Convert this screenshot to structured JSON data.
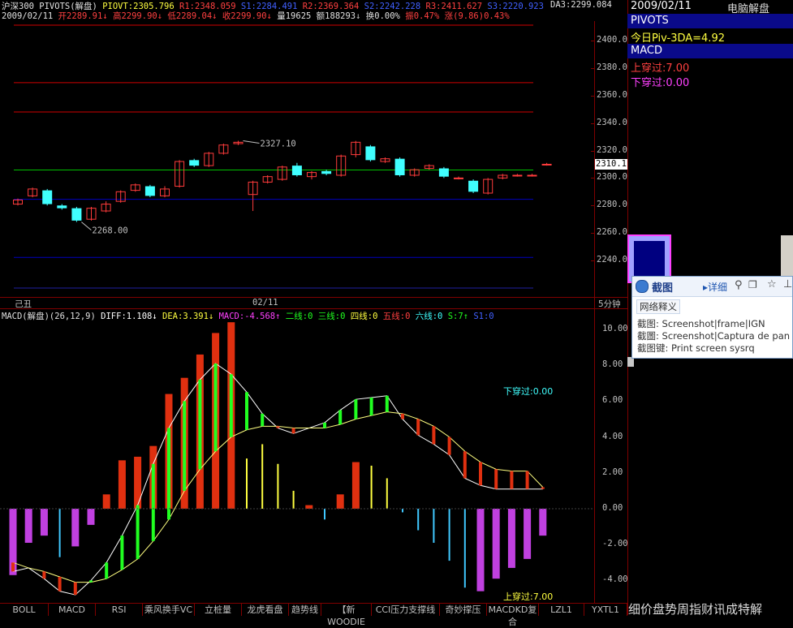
{
  "header": {
    "title": "沪深300 PIVOTS(解盘)",
    "pivot": "PIOVT:2305.796",
    "r1": "R1:2348.059",
    "s1": "S1:2284.491",
    "r2": "R2:2369.364",
    "s2": "S2:2242.228",
    "r3": "R3:2411.627",
    "s3": "S3:2220.923",
    "da3": "DA3:2299.084"
  },
  "quote": {
    "date": "2009/02/11",
    "open": "开2289.91",
    "high": "高2299.90",
    "low": "低2289.04",
    "close": "收2299.90",
    "volume": "量19625",
    "amount": "额188293",
    "turnover": "换0.00%",
    "amplitude": "振0.47%",
    "change": "涨(9.86)0.43%"
  },
  "main_axis": {
    "ticks": [
      "2400.00",
      "2380.00",
      "2360.00",
      "2340.00",
      "2320.00",
      "2300.00",
      "2280.00",
      "2260.00",
      "2240.00"
    ],
    "current_price": "2310.1",
    "date_left": "己丑",
    "date_mid": "02/11",
    "period": "5分钟"
  },
  "annotations": {
    "high_label": "2327.10",
    "low_label": "2268.00"
  },
  "macd_header": {
    "name": "MACD(解盘)(26,12,9)",
    "diff": "DIFF:1.108",
    "dea": "DEA:3.391",
    "macd": "MACD:-4.568",
    "l2": "二线:0",
    "l3": "三线:0",
    "l4": "四线:0",
    "l5": "五线:0",
    "l6": "六线:0",
    "s": "S:7",
    "s1": "S1:0"
  },
  "macd_axis": {
    "ticks": [
      "10.00",
      "8.00",
      "6.00",
      "4.00",
      "2.00",
      "0.00",
      "-2.00",
      "-4.00"
    ]
  },
  "macd_labels": {
    "cross_down": "下穿过:0.00",
    "cross_up": "上穿过:7.00"
  },
  "right_panel": {
    "date": "2009/02/11",
    "brand": "电脑解盘",
    "pivots_title": "PIVOTS",
    "pivots_value": "今日Piv-3DA=4.92",
    "macd_title": "MACD",
    "cross_up": "上穿过:7.00",
    "cross_down": "下穿过:0.00",
    "footer": "细价盘势周指财讯成特解"
  },
  "popup": {
    "title": "截图",
    "detail": "详细",
    "section": "网络释义",
    "line1": "截图: Screenshot|frame|IGN",
    "line2": "截圖: Screenshot|Captura de pan",
    "line3": "截图键: Print screen sysrq"
  },
  "tabs": [
    "BOLL",
    "MACD",
    "RSI",
    "乘风换手VC",
    "立桩量",
    "龙虎看盘",
    "趋势线",
    "【新WOODIE",
    "CCI压力支撑线",
    "奇妙撑压",
    "MACDKD复合",
    "LZL1",
    "YXTL1"
  ],
  "colors": {
    "up": "#ff3b3b",
    "down": "#40ffff",
    "pivot_line": "#00c000",
    "resistance": "#d00000",
    "support": "#0000c0",
    "macd_red": "#e03010",
    "macd_green": "#20ff20",
    "macd_magenta": "#c040e0",
    "macd_cyan": "#40c8ff",
    "macd_yellow": "#ffff40"
  },
  "chart_data": [
    {
      "type": "candlestick",
      "title": "沪深300 PIVOTS(解盘)",
      "ylim": [
        2230,
        2410
      ],
      "levels": {
        "pivot": 2305.796,
        "r1": 2348.059,
        "r2": 2369.364,
        "r3": 2411.627,
        "s1": 2284.491,
        "s2": 2242.228,
        "s3": 2220.923
      },
      "candles": [
        {
          "o": 2281,
          "c": 2284,
          "h": 2285,
          "l": 2280
        },
        {
          "o": 2287,
          "c": 2292,
          "h": 2293,
          "l": 2286
        },
        {
          "o": 2291,
          "c": 2281,
          "h": 2292,
          "l": 2280
        },
        {
          "o": 2280,
          "c": 2278,
          "h": 2281,
          "l": 2277
        },
        {
          "o": 2278,
          "c": 2269,
          "h": 2279,
          "l": 2268
        },
        {
          "o": 2270,
          "c": 2278,
          "h": 2279,
          "l": 2269
        },
        {
          "o": 2276,
          "c": 2281,
          "h": 2283,
          "l": 2275
        },
        {
          "o": 2283,
          "c": 2290,
          "h": 2291,
          "l": 2282
        },
        {
          "o": 2291,
          "c": 2295,
          "h": 2296,
          "l": 2290
        },
        {
          "o": 2294,
          "c": 2287,
          "h": 2295,
          "l": 2286
        },
        {
          "o": 2287,
          "c": 2292,
          "h": 2294,
          "l": 2286
        },
        {
          "o": 2294,
          "c": 2312,
          "h": 2313,
          "l": 2293
        },
        {
          "o": 2313,
          "c": 2309,
          "h": 2314,
          "l": 2308
        },
        {
          "o": 2309,
          "c": 2318,
          "h": 2319,
          "l": 2308
        },
        {
          "o": 2318,
          "c": 2324,
          "h": 2325,
          "l": 2317
        },
        {
          "o": 2325,
          "c": 2326,
          "h": 2327.1,
          "l": 2324
        },
        {
          "o": 2288,
          "c": 2297,
          "h": 2298,
          "l": 2276
        },
        {
          "o": 2297,
          "c": 2301,
          "h": 2302,
          "l": 2296
        },
        {
          "o": 2299,
          "c": 2308,
          "h": 2309,
          "l": 2298
        },
        {
          "o": 2309,
          "c": 2302,
          "h": 2311,
          "l": 2301
        },
        {
          "o": 2301,
          "c": 2304,
          "h": 2305,
          "l": 2299
        },
        {
          "o": 2305,
          "c": 2303,
          "h": 2306,
          "l": 2302
        },
        {
          "o": 2302,
          "c": 2316,
          "h": 2317,
          "l": 2301
        },
        {
          "o": 2317,
          "c": 2326,
          "h": 2327,
          "l": 2315
        },
        {
          "o": 2323,
          "c": 2313,
          "h": 2324,
          "l": 2312
        },
        {
          "o": 2312,
          "c": 2314,
          "h": 2315,
          "l": 2311
        },
        {
          "o": 2314,
          "c": 2302,
          "h": 2315,
          "l": 2301
        },
        {
          "o": 2302,
          "c": 2306,
          "h": 2307,
          "l": 2301
        },
        {
          "o": 2307,
          "c": 2309,
          "h": 2310,
          "l": 2306
        },
        {
          "o": 2307,
          "c": 2301,
          "h": 2308,
          "l": 2300
        },
        {
          "o": 2300,
          "c": 2300,
          "h": 2301,
          "l": 2299
        },
        {
          "o": 2298,
          "c": 2290,
          "h": 2299,
          "l": 2289
        },
        {
          "o": 2289,
          "c": 2299,
          "h": 2300,
          "l": 2288
        },
        {
          "o": 2300,
          "c": 2302,
          "h": 2303,
          "l": 2299
        },
        {
          "o": 2302,
          "c": 2302,
          "h": 2303,
          "l": 2301
        },
        {
          "o": 2302,
          "c": 2302,
          "h": 2303,
          "l": 2301
        },
        {
          "o": 2310,
          "c": 2310,
          "h": 2311,
          "l": 2309
        }
      ]
    },
    {
      "type": "bar",
      "title": "MACD(解盘)(26,12,9)",
      "ylim": [
        -5,
        10.6
      ],
      "bars": [
        {
          "v": -3.7,
          "c": "m"
        },
        {
          "v": -1.9,
          "c": "m"
        },
        {
          "v": -1.5,
          "c": "m"
        },
        {
          "v": -2.7,
          "c": "c"
        },
        {
          "v": -2.1,
          "c": "m"
        },
        {
          "v": -0.9,
          "c": "m"
        },
        {
          "v": 0.8,
          "c": "r"
        },
        {
          "v": 2.7,
          "c": "r"
        },
        {
          "v": 2.9,
          "c": "r"
        },
        {
          "v": 3.5,
          "c": "r"
        },
        {
          "v": 6.4,
          "c": "r"
        },
        {
          "v": 7.3,
          "c": "r"
        },
        {
          "v": 8.6,
          "c": "r"
        },
        {
          "v": 9.8,
          "c": "r"
        },
        {
          "v": 10.4,
          "c": "r"
        },
        {
          "v": 2.8,
          "c": "y"
        },
        {
          "v": 3.6,
          "c": "y"
        },
        {
          "v": 2.5,
          "c": "y"
        },
        {
          "v": 1.0,
          "c": "y"
        },
        {
          "v": 0.2,
          "c": "r"
        },
        {
          "v": -0.6,
          "c": "c"
        },
        {
          "v": 0.8,
          "c": "r"
        },
        {
          "v": 2.6,
          "c": "r"
        },
        {
          "v": 2.4,
          "c": "y"
        },
        {
          "v": 1.7,
          "c": "y"
        },
        {
          "v": -0.2,
          "c": "c"
        },
        {
          "v": -1.2,
          "c": "c"
        },
        {
          "v": -1.9,
          "c": "c"
        },
        {
          "v": -2.9,
          "c": "c"
        },
        {
          "v": -4.4,
          "c": "c"
        },
        {
          "v": -4.6,
          "c": "m"
        },
        {
          "v": -3.9,
          "c": "m"
        },
        {
          "v": -3.3,
          "c": "m"
        },
        {
          "v": -2.8,
          "c": "m"
        },
        {
          "v": -1.5,
          "c": "m"
        }
      ],
      "diff": [
        -3.5,
        -3.3,
        -3.9,
        -4.6,
        -4.8,
        -4.0,
        -3.0,
        -1.5,
        0.2,
        2.5,
        4.5,
        6.0,
        7.2,
        8.1,
        7.5,
        6.5,
        5.3,
        4.5,
        4.2,
        4.5,
        4.8,
        5.5,
        6.1,
        6.2,
        6.3,
        5.0,
        4.1,
        3.6,
        3.0,
        1.7,
        1.3,
        1.1,
        1.1,
        1.1,
        1.1
      ],
      "dea": [
        -3.0,
        -3.3,
        -3.5,
        -3.8,
        -4.1,
        -4.1,
        -3.9,
        -3.4,
        -2.8,
        -1.8,
        -0.6,
        1.0,
        2.2,
        3.2,
        4.0,
        4.4,
        4.6,
        4.6,
        4.5,
        4.5,
        4.5,
        4.7,
        5.0,
        5.2,
        5.4,
        5.3,
        5.0,
        4.6,
        4.0,
        3.2,
        2.6,
        2.2,
        2.1,
        2.1,
        1.2
      ]
    }
  ]
}
